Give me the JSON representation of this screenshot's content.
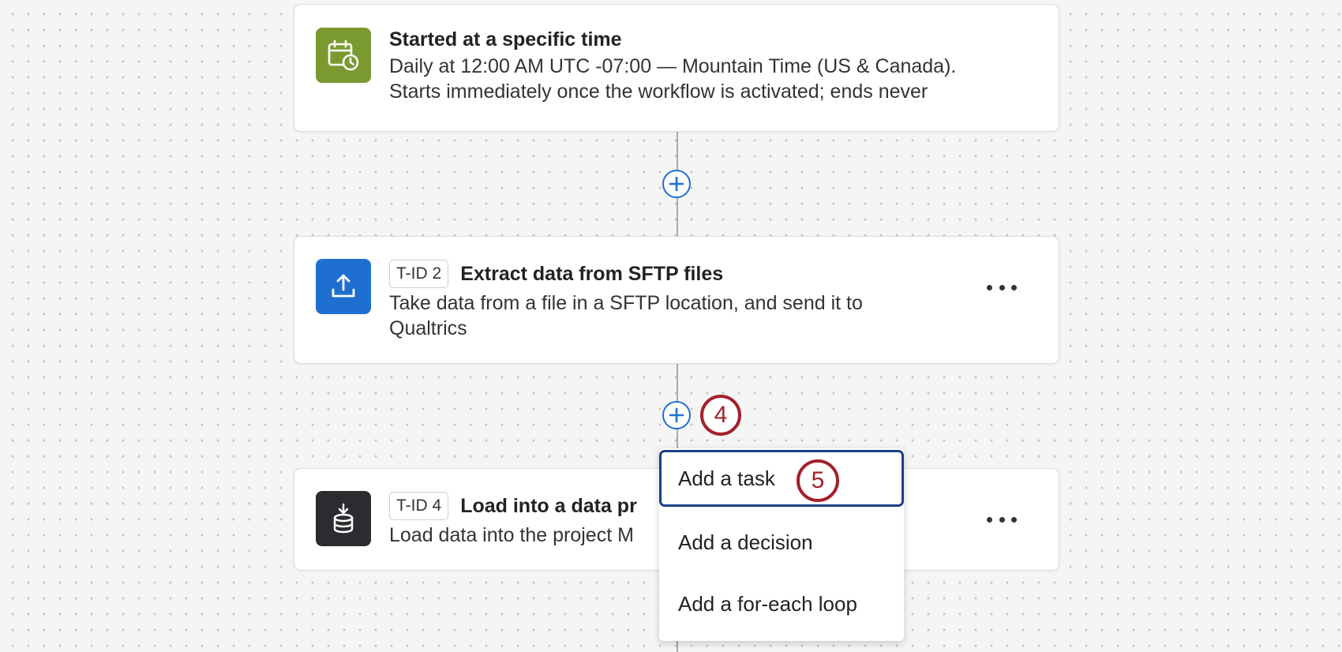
{
  "workflow": {
    "trigger": {
      "title": "Started at a specific time",
      "description": "Daily at 12:00 AM UTC -07:00 — Mountain Time (US & Canada).\nStarts immediately once the workflow is activated; ends never",
      "icon": "calendar-clock-icon",
      "icon_color": "#7a9a31"
    },
    "tasks": [
      {
        "id_badge": "T-ID 2",
        "title": "Extract data from SFTP files",
        "description": "Take data from a file in a SFTP location, and send it to\nQualtrics",
        "icon": "upload-icon",
        "icon_color": "#1f6fd0"
      },
      {
        "id_badge": "T-ID 4",
        "title": "Load into a data pr",
        "description": "Load data into the project M",
        "icon": "database-download-icon",
        "icon_color": "#2a2c30"
      }
    ]
  },
  "add_menu": {
    "items": [
      "Add a task",
      "Add a decision",
      "Add a for-each loop"
    ],
    "focused_index": 0
  },
  "callouts": [
    "4",
    "5"
  ],
  "colors": {
    "accent": "#1f6fd0",
    "callout": "#a3202b",
    "focus_border": "#1d3f8a"
  }
}
